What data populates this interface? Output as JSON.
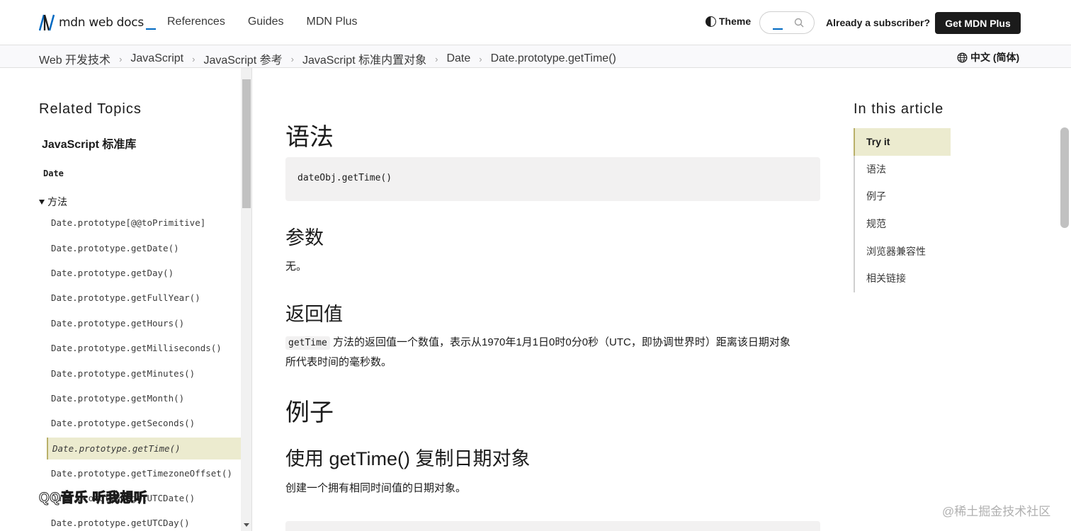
{
  "header": {
    "logo_text": "mdn web docs",
    "nav": [
      "References",
      "Guides",
      "MDN Plus"
    ],
    "theme_label": "Theme",
    "subscriber_label": "Already a subscriber?",
    "get_plus_label": "Get MDN Plus"
  },
  "breadcrumb": {
    "items": [
      "Web 开发技术",
      "JavaScript",
      "JavaScript 参考",
      "JavaScript 标准内置对象",
      "Date",
      "Date.prototype.getTime()"
    ],
    "separator": "›",
    "language": "中文 (简体)"
  },
  "sidebar": {
    "title": "Related Topics",
    "library": "JavaScript 标准库",
    "object": "Date",
    "group": "方法",
    "items": [
      "Date.prototype[@@toPrimitive]",
      "Date.prototype.getDate()",
      "Date.prototype.getDay()",
      "Date.prototype.getFullYear()",
      "Date.prototype.getHours()",
      "Date.prototype.getMilliseconds()",
      "Date.prototype.getMinutes()",
      "Date.prototype.getMonth()",
      "Date.prototype.getSeconds()",
      "Date.prototype.getTime()",
      "Date.prototype.getTimezoneOffset()",
      "Date.prototype.getUTCDate()",
      "Date.prototype.getUTCDay()"
    ],
    "active_index": 9
  },
  "main": {
    "syntax_heading": "语法",
    "syntax_code": "dateObj.getTime()",
    "params_heading": "参数",
    "params_text": "无。",
    "return_heading": "返回值",
    "return_code": "getTime",
    "return_text_line1": "方法的返回值一个数值，表示从1970年1月1日0时0分0秒（UTC，即协调世界时）距离该日期对象",
    "return_text_line2": "所代表时间的毫秒数。",
    "examples_heading": "例子",
    "example1_heading": "使用 getTime() 复制日期对象",
    "example1_text": "创建一个拥有相同时间值的日期对象。"
  },
  "toc": {
    "title": "In this article",
    "items": [
      "Try it",
      "语法",
      "例子",
      "规范",
      "浏览器兼容性",
      "相关链接"
    ],
    "active_index": 0
  },
  "overlay": {
    "music_text": "QQ音乐 听我想听",
    "watermark": "@稀土掘金技术社区"
  },
  "colors": {
    "active_highlight": "#ecebcf",
    "button_dark": "#1b1b1b",
    "accent_blue": "#0069c2"
  }
}
